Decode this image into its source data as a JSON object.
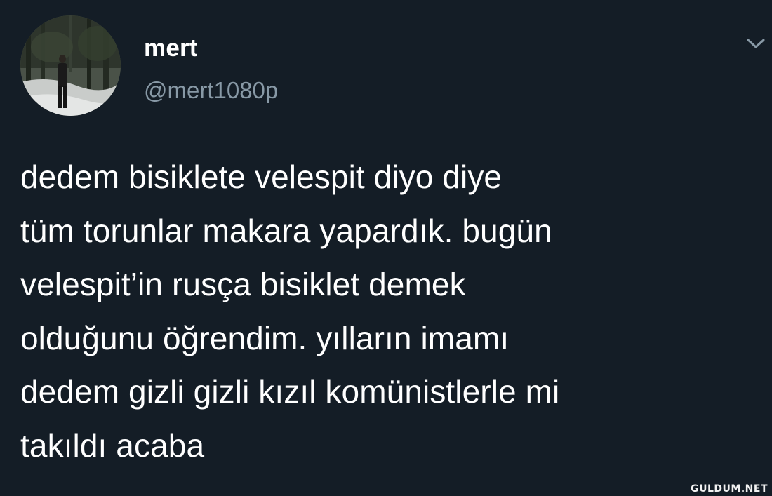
{
  "tweet": {
    "author": {
      "display_name": "mert",
      "handle": "@mert1080p",
      "avatar_icon": "profile-photo-forest"
    },
    "menu_icon": "chevron-down-icon",
    "text_lines": [
      "dedem bisiklete velespit diyo diye",
      "tüm torunlar makara yapardık. bugün",
      "velespit’in rusça bisiklet demek",
      "olduğunu öğrendim. yılların imamı",
      "dedem gizli gizli kızıl komünistlerle mi",
      "takıldı acaba"
    ]
  },
  "watermark": {
    "text": "GULDUM.NET"
  },
  "colors": {
    "background": "#141d26",
    "primary_text": "#ffffff",
    "secondary_text": "#8899a6"
  }
}
